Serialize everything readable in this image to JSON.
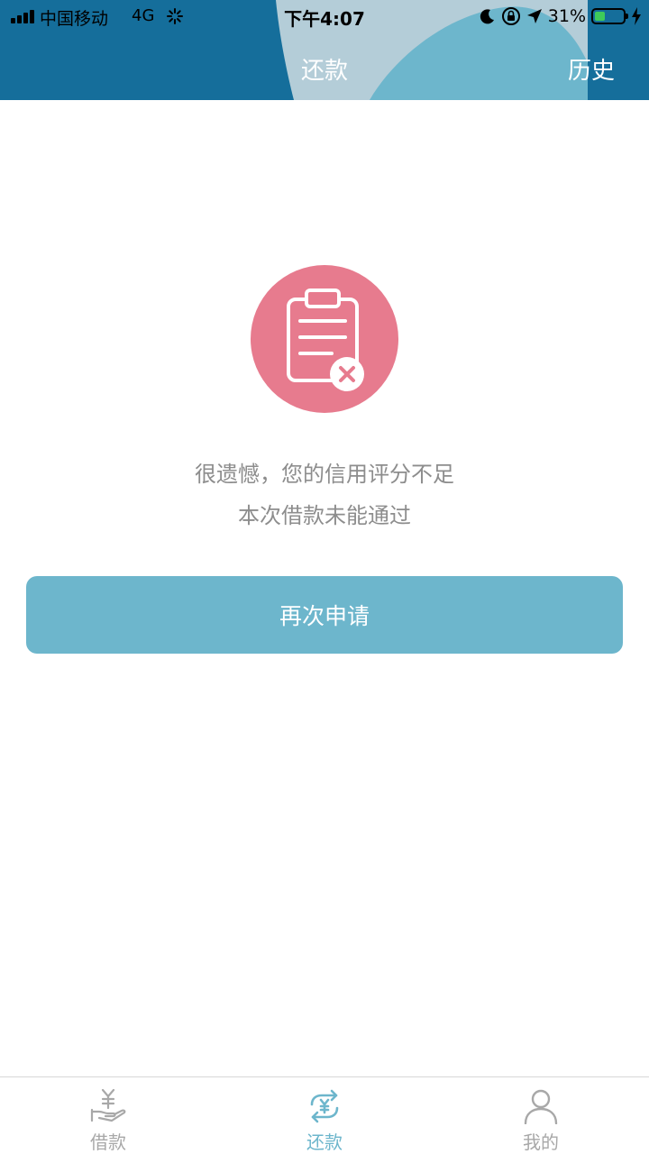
{
  "status_bar": {
    "carrier": "中国移动",
    "network": "4G",
    "time": "下午4:07",
    "battery_percent": "31%",
    "icons": [
      "signal-icon",
      "loading-icon",
      "moon-icon",
      "rotation-lock-icon",
      "location-icon",
      "battery-icon",
      "charging-icon"
    ]
  },
  "nav": {
    "title": "还款",
    "history_label": "历史"
  },
  "result": {
    "icon": "clipboard-rejected-icon",
    "message_line1": "很遗憾，您的信用评分不足",
    "message_line2": "本次借款未能通过",
    "retry_label": "再次申请"
  },
  "tabs": [
    {
      "label": "借款",
      "icon": "hand-yen-icon",
      "active": false
    },
    {
      "label": "还款",
      "icon": "repay-exchange-icon",
      "active": true
    },
    {
      "label": "我的",
      "icon": "user-icon",
      "active": false
    }
  ],
  "colors": {
    "header_blue": "#156e9b",
    "header_wave": "#6db6cc",
    "accent": "#6db6cc",
    "reject_pink": "#e77b8e",
    "message_gray": "#8d8d8d",
    "tab_inactive": "#a8a8a8"
  }
}
